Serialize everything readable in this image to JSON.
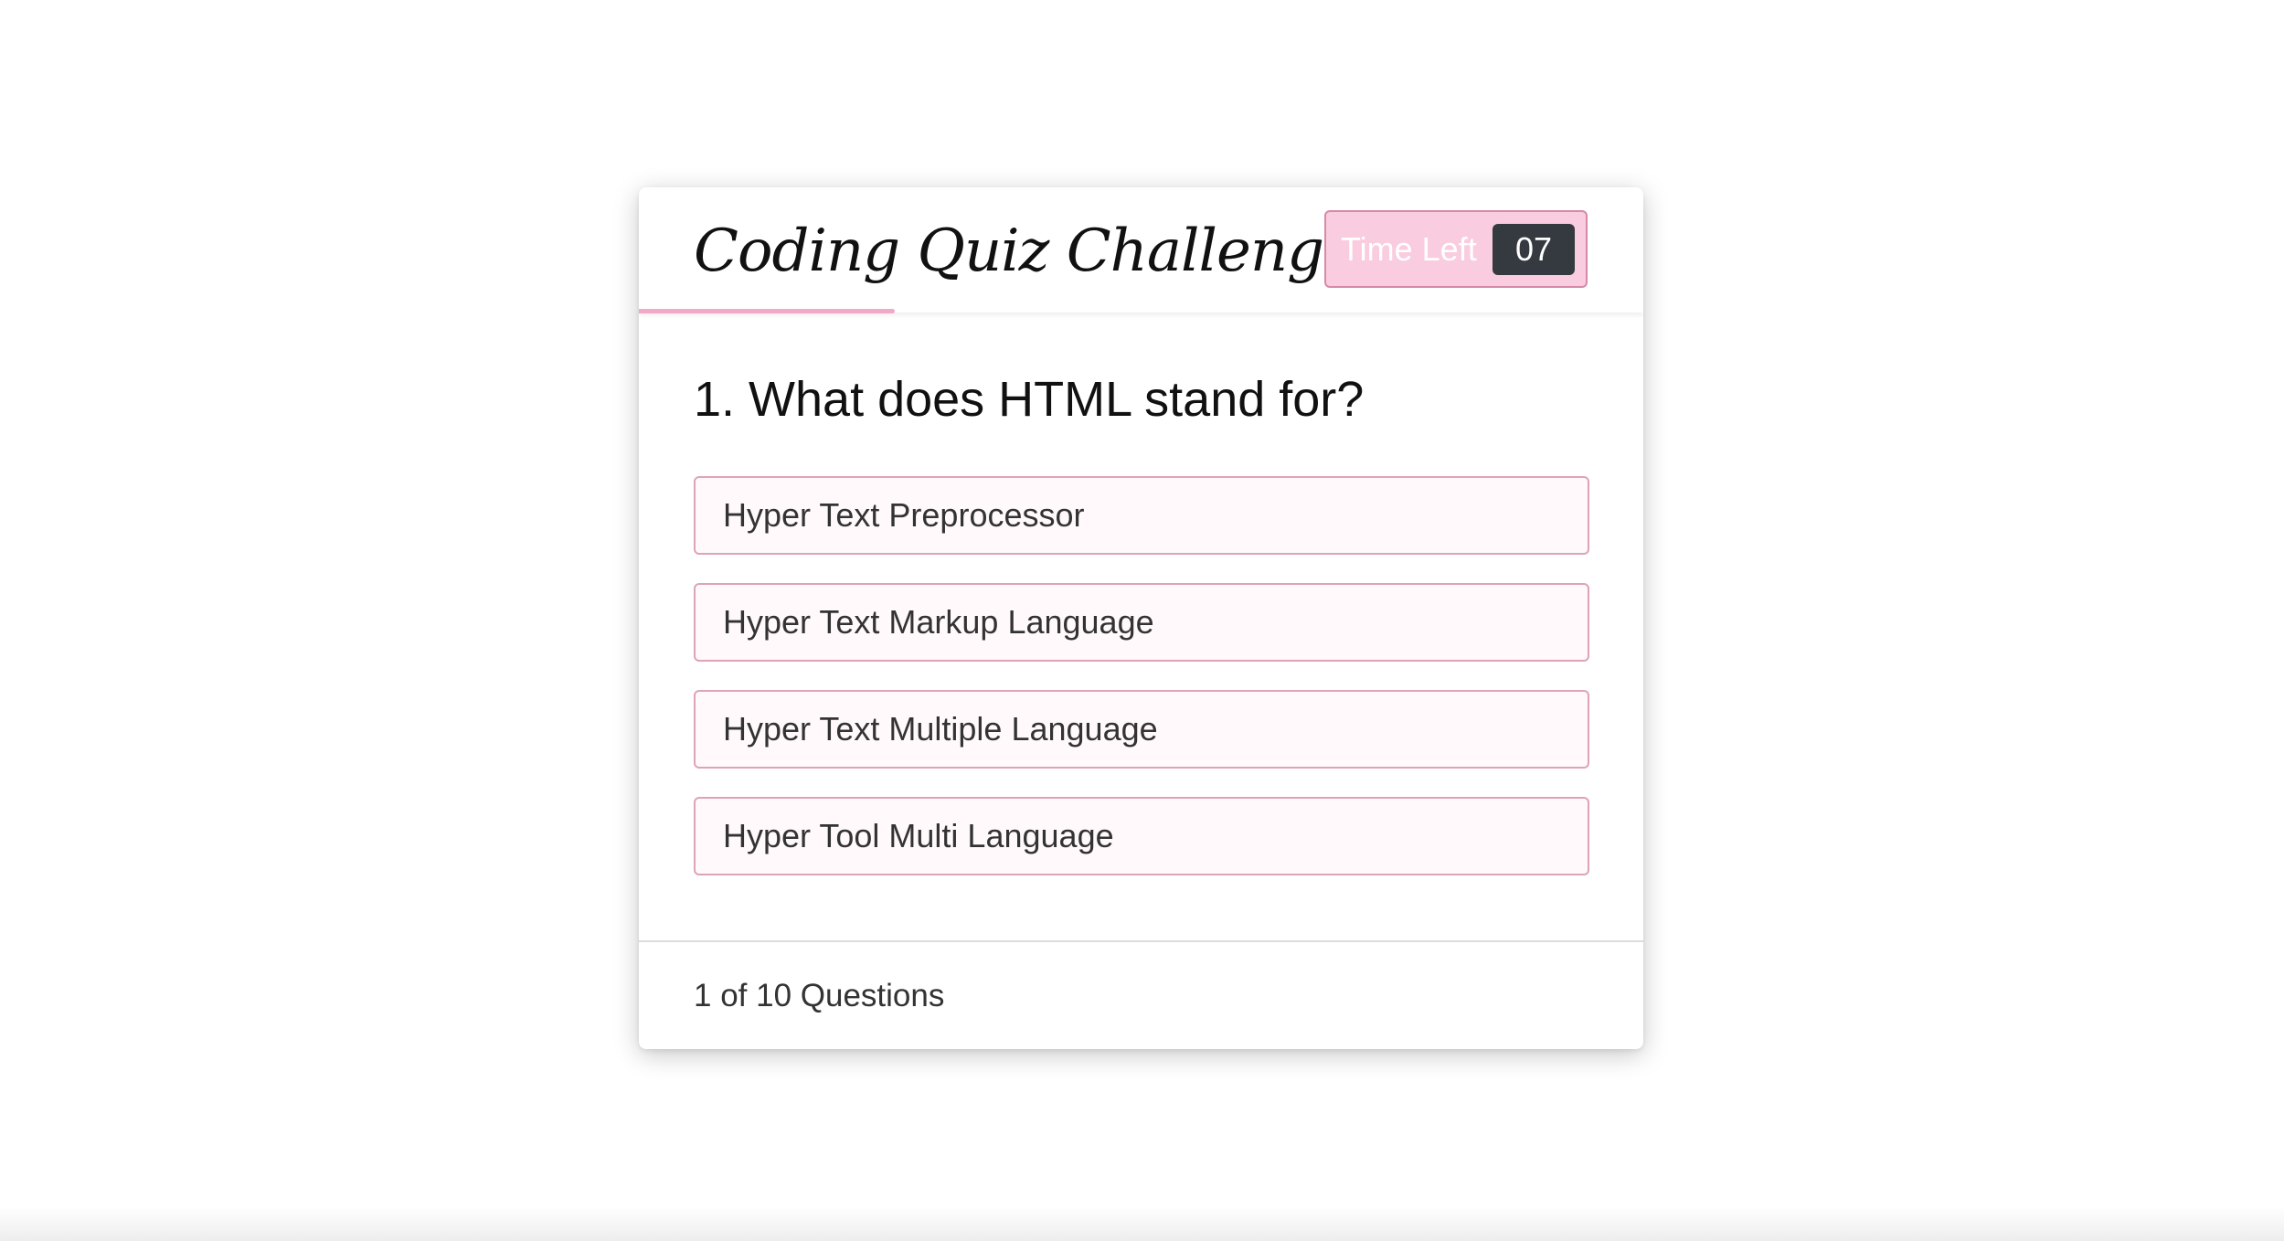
{
  "colors": {
    "accent_pink": "#f0a9c7",
    "timer_background": "#f9ccdf",
    "timer_value_background": "#343a40",
    "option_border": "#dda3ba"
  },
  "header": {
    "title": "Coding Quiz Challenge",
    "timer_label": "Time Left",
    "timer_value": "07"
  },
  "question": {
    "text": "1. What does HTML stand for?",
    "options": [
      "Hyper Text Preprocessor",
      "Hyper Text Markup Language",
      "Hyper Text Multiple Language",
      "Hyper Tool Multi Language"
    ]
  },
  "footer": {
    "counter": "1 of 10 Questions"
  }
}
